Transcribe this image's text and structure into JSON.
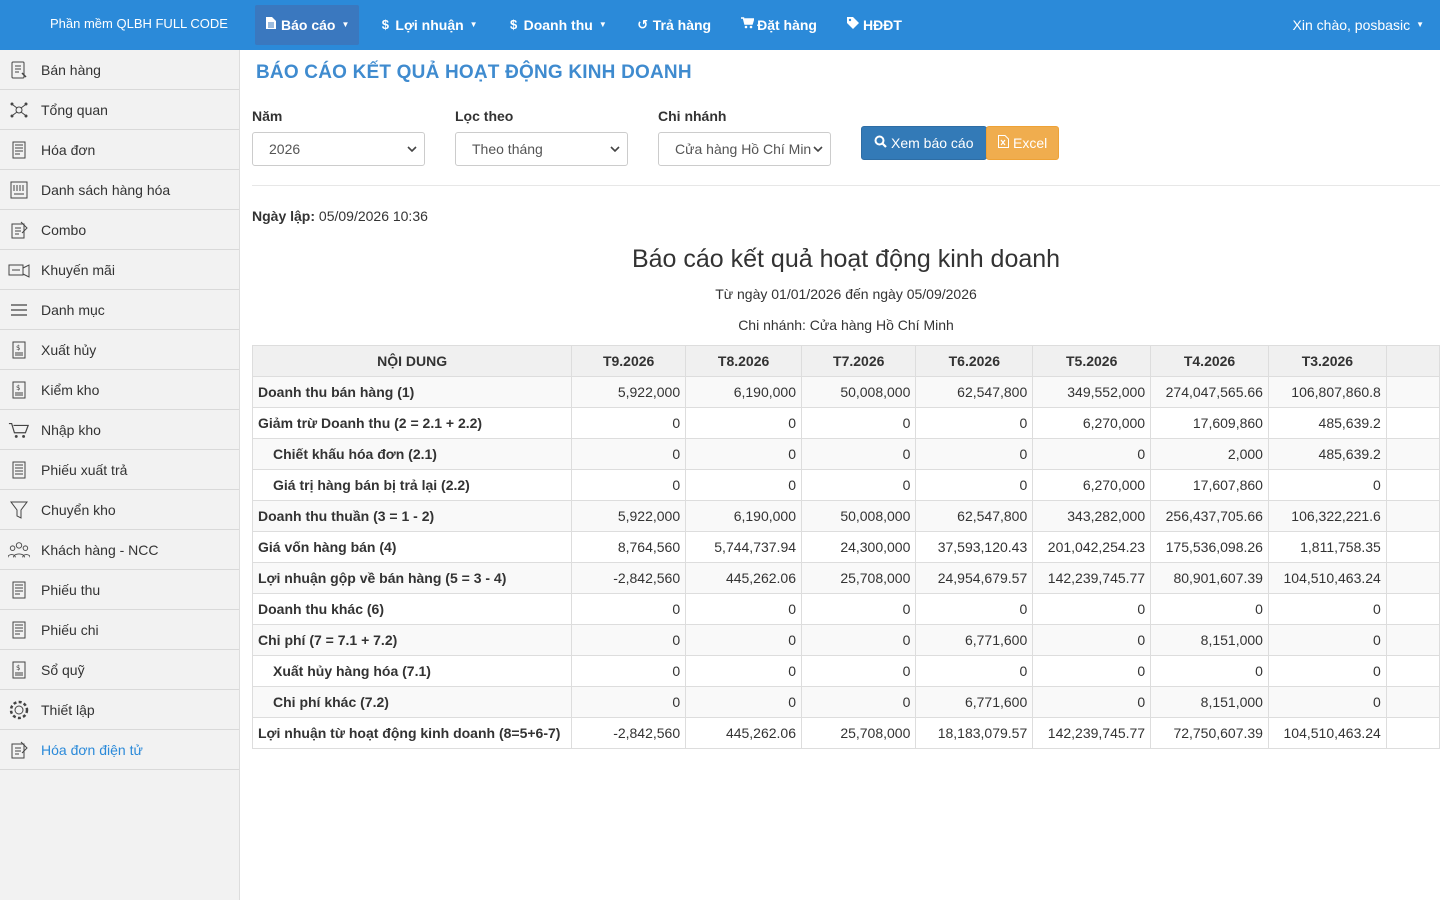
{
  "app": {
    "brand": "Phần mềm QLBH FULL CODE",
    "greeting": "Xin chào, posbasic"
  },
  "nav": [
    {
      "label": "Báo cáo",
      "icon": "file-icon",
      "dropdown": true,
      "active": true
    },
    {
      "label": "Lợi nhuận",
      "icon": "dollar-icon",
      "dropdown": true
    },
    {
      "label": "Doanh thu",
      "icon": "dollar-icon",
      "dropdown": true
    },
    {
      "label": "Trả hàng",
      "icon": "undo-icon",
      "dropdown": false
    },
    {
      "label": "Đặt hàng",
      "icon": "cart-icon",
      "dropdown": false
    },
    {
      "label": "HĐĐT",
      "icon": "tag-icon",
      "dropdown": false
    }
  ],
  "sidebar": [
    {
      "label": "Bán hàng",
      "icon": "sales-icon"
    },
    {
      "label": "Tổng quan",
      "icon": "overview-icon"
    },
    {
      "label": "Hóa đơn",
      "icon": "invoice-icon"
    },
    {
      "label": "Danh sách hàng hóa",
      "icon": "product-list-icon"
    },
    {
      "label": "Combo",
      "icon": "combo-icon"
    },
    {
      "label": "Khuyến mãi",
      "icon": "promotion-icon"
    },
    {
      "label": "Danh mục",
      "icon": "list-icon"
    },
    {
      "label": "Xuất hủy",
      "icon": "dispose-icon"
    },
    {
      "label": "Kiểm kho",
      "icon": "stock-check-icon"
    },
    {
      "label": "Nhập kho",
      "icon": "import-cart-icon"
    },
    {
      "label": "Phiếu xuất trả",
      "icon": "return-slip-icon"
    },
    {
      "label": "Chuyển kho",
      "icon": "filter-icon"
    },
    {
      "label": "Khách hàng - NCC",
      "icon": "customers-icon"
    },
    {
      "label": "Phiếu thu",
      "icon": "receipt-icon"
    },
    {
      "label": "Phiếu chi",
      "icon": "payment-icon"
    },
    {
      "label": "Sổ quỹ",
      "icon": "cashbook-icon"
    },
    {
      "label": "Thiết lập",
      "icon": "gear-icon"
    },
    {
      "label": "Hóa đơn điện tử",
      "icon": "e-invoice-icon",
      "active": true
    }
  ],
  "page": {
    "title": "BÁO CÁO KẾT QUẢ HOẠT ĐỘNG KINH DOANH",
    "filters": {
      "year_label": "Năm",
      "year_value": "2026",
      "filter_label": "Lọc theo",
      "filter_value": "Theo tháng",
      "branch_label": "Chi nhánh",
      "branch_value": "Cửa hàng Hồ Chí Minh"
    },
    "view_button": "Xem báo cáo",
    "excel_button": "Excel",
    "created_label": "Ngày lập:",
    "created_value": "05/09/2026 10:36"
  },
  "report": {
    "title": "Báo cáo kết quả hoạt động kinh doanh",
    "range": "Từ ngày 01/01/2026 đến ngày 05/09/2026",
    "branch": "Chi nhánh: Cửa hàng Hồ Chí Minh",
    "columns": [
      "NỘI DUNG",
      "T9.2026",
      "T8.2026",
      "T7.2026",
      "T6.2026",
      "T5.2026",
      "T4.2026",
      "T3.2026"
    ],
    "rows": [
      {
        "label": "Doanh thu bán hàng (1)",
        "sub": false,
        "values": [
          "5,922,000",
          "6,190,000",
          "50,008,000",
          "62,547,800",
          "349,552,000",
          "274,047,565.66",
          "106,807,860.8"
        ]
      },
      {
        "label": "Giảm trừ Doanh thu (2 = 2.1 + 2.2)",
        "sub": false,
        "values": [
          "0",
          "0",
          "0",
          "0",
          "6,270,000",
          "17,609,860",
          "485,639.2"
        ]
      },
      {
        "label": "Chiết khấu hóa đơn (2.1)",
        "sub": true,
        "values": [
          "0",
          "0",
          "0",
          "0",
          "0",
          "2,000",
          "485,639.2"
        ]
      },
      {
        "label": "Giá trị hàng bán bị trả lại (2.2)",
        "sub": true,
        "values": [
          "0",
          "0",
          "0",
          "0",
          "6,270,000",
          "17,607,860",
          "0"
        ]
      },
      {
        "label": "Doanh thu thuần (3 = 1 - 2)",
        "sub": false,
        "values": [
          "5,922,000",
          "6,190,000",
          "50,008,000",
          "62,547,800",
          "343,282,000",
          "256,437,705.66",
          "106,322,221.6"
        ]
      },
      {
        "label": "Giá vốn hàng bán (4)",
        "sub": false,
        "values": [
          "8,764,560",
          "5,744,737.94",
          "24,300,000",
          "37,593,120.43",
          "201,042,254.23",
          "175,536,098.26",
          "1,811,758.35"
        ]
      },
      {
        "label": "Lợi nhuận gộp về bán hàng (5 = 3 - 4)",
        "sub": false,
        "values": [
          "-2,842,560",
          "445,262.06",
          "25,708,000",
          "24,954,679.57",
          "142,239,745.77",
          "80,901,607.39",
          "104,510,463.24"
        ]
      },
      {
        "label": "Doanh thu khác (6)",
        "sub": false,
        "values": [
          "0",
          "0",
          "0",
          "0",
          "0",
          "0",
          "0"
        ]
      },
      {
        "label": "Chi phí (7 = 7.1 + 7.2)",
        "sub": false,
        "values": [
          "0",
          "0",
          "0",
          "6,771,600",
          "0",
          "8,151,000",
          "0"
        ]
      },
      {
        "label": "Xuất hủy hàng hóa (7.1)",
        "sub": true,
        "values": [
          "0",
          "0",
          "0",
          "0",
          "0",
          "0",
          "0"
        ]
      },
      {
        "label": "Chi phí khác (7.2)",
        "sub": true,
        "values": [
          "0",
          "0",
          "0",
          "6,771,600",
          "0",
          "8,151,000",
          "0"
        ]
      },
      {
        "label": "Lợi nhuận từ hoạt động kinh doanh (8=5+6-7)",
        "sub": false,
        "values": [
          "-2,842,560",
          "445,262.06",
          "25,708,000",
          "18,183,079.57",
          "142,239,745.77",
          "72,750,607.39",
          "104,510,463.24"
        ]
      }
    ]
  },
  "colors": {
    "nav_bg": "#2b8ad9",
    "title": "#3f8bcf",
    "primary": "#337ab7",
    "warning": "#f0ad4e"
  }
}
